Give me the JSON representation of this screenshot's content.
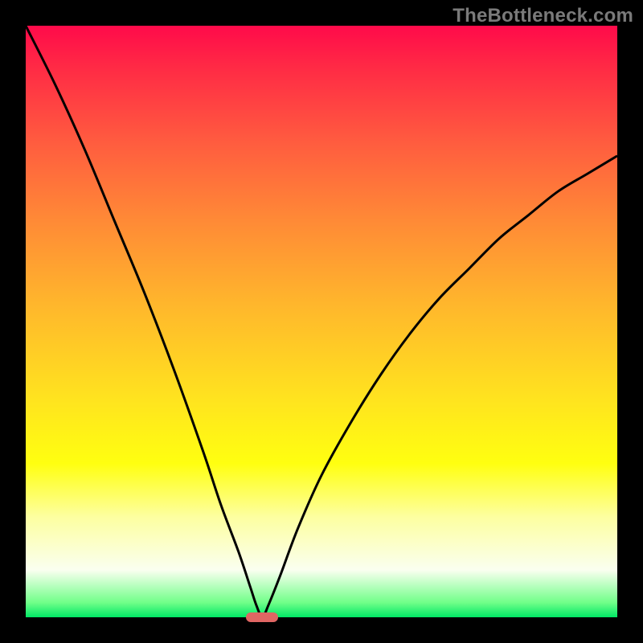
{
  "watermark": "TheBottleneck.com",
  "chart_data": {
    "type": "line",
    "title": "",
    "xlabel": "",
    "ylabel": "",
    "x_range": [
      0,
      100
    ],
    "y_range": [
      0,
      100
    ],
    "minimum_x": 40,
    "marker": {
      "x": 40,
      "y": 0
    },
    "series": [
      {
        "name": "bottleneck-curve",
        "x": [
          0,
          5,
          10,
          15,
          20,
          25,
          30,
          33,
          36,
          38,
          39,
          40,
          41,
          43,
          46,
          50,
          55,
          60,
          65,
          70,
          75,
          80,
          85,
          90,
          95,
          100
        ],
        "y": [
          100,
          90,
          79,
          67,
          55,
          42,
          28,
          19,
          11,
          5,
          2,
          0,
          2,
          7,
          15,
          24,
          33,
          41,
          48,
          54,
          59,
          64,
          68,
          72,
          75,
          78
        ]
      }
    ],
    "gradient_stops": [
      {
        "pct": 0,
        "color": "#ff0a4a"
      },
      {
        "pct": 7,
        "color": "#ff2a45"
      },
      {
        "pct": 20,
        "color": "#ff5d3f"
      },
      {
        "pct": 33,
        "color": "#ff8a36"
      },
      {
        "pct": 47,
        "color": "#ffb62c"
      },
      {
        "pct": 63,
        "color": "#ffe31f"
      },
      {
        "pct": 74,
        "color": "#ffff10"
      },
      {
        "pct": 83,
        "color": "#fdffa0"
      },
      {
        "pct": 92,
        "color": "#fafff0"
      },
      {
        "pct": 97.5,
        "color": "#71ff89"
      },
      {
        "pct": 100,
        "color": "#00e865"
      }
    ]
  }
}
